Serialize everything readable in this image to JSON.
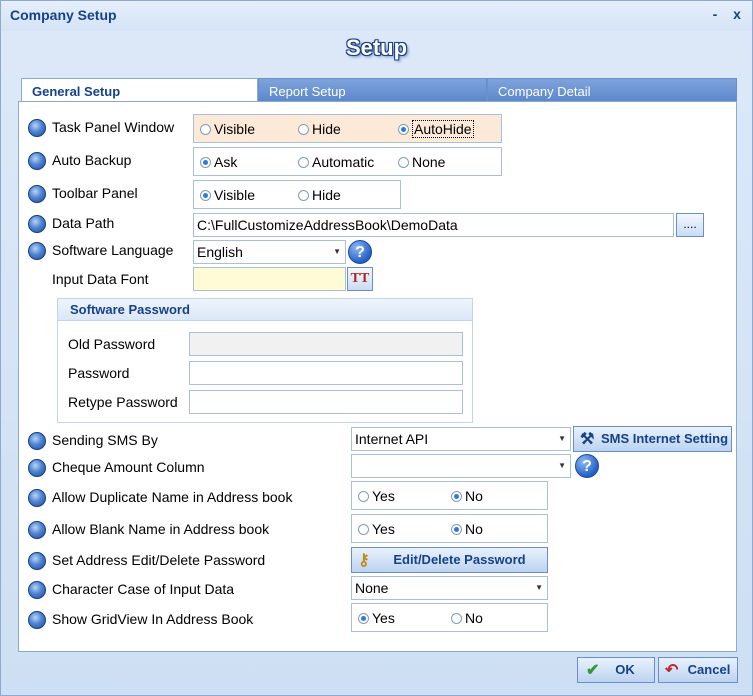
{
  "window": {
    "title": "Company Setup",
    "minimize": "-",
    "close": "x",
    "heading": "Setup"
  },
  "tabs": [
    {
      "label": "General Setup",
      "active": true
    },
    {
      "label": "Report Setup",
      "active": false
    },
    {
      "label": "Company Detail",
      "active": false
    }
  ],
  "general": {
    "task_panel": {
      "label": "Task Panel Window",
      "options": [
        "Visible",
        "Hide",
        "AutoHide"
      ],
      "selected": "AutoHide"
    },
    "auto_backup": {
      "label": "Auto Backup",
      "options": [
        "Ask",
        "Automatic",
        "None"
      ],
      "selected": "Ask"
    },
    "toolbar_panel": {
      "label": "Toolbar Panel",
      "options": [
        "Visible",
        "Hide"
      ],
      "selected": "Visible"
    },
    "data_path": {
      "label": "Data Path",
      "value": "C:\\FullCustomizeAddressBook\\DemoData",
      "browse": "...."
    },
    "language": {
      "label": "Software Language",
      "value": "English",
      "help": "?"
    },
    "input_font": {
      "label": "Input Data Font",
      "value": "",
      "font_btn": "TT"
    },
    "password_group": {
      "title": "Software Password",
      "old_label": "Old Password",
      "new_label": "Password",
      "retype_label": "Retype Password"
    },
    "sms": {
      "label": "Sending SMS By",
      "value": "Internet API",
      "button": "SMS Internet Setting"
    },
    "cheque": {
      "label": "Cheque Amount Column",
      "value": "",
      "help": "?"
    },
    "dup_name": {
      "label": "Allow Duplicate Name in Address book",
      "options": [
        "Yes",
        "No"
      ],
      "selected": "No"
    },
    "blank_name": {
      "label": "Allow Blank Name in Address book",
      "options": [
        "Yes",
        "No"
      ],
      "selected": "No"
    },
    "edit_pwd": {
      "label": "Set Address Edit/Delete Password",
      "button": "Edit/Delete Password"
    },
    "char_case": {
      "label": "Character Case of Input Data",
      "value": "None"
    },
    "gridview": {
      "label": "Show GridView In Address Book",
      "options": [
        "Yes",
        "No"
      ],
      "selected": "Yes"
    }
  },
  "footer": {
    "ok": "OK",
    "cancel": "Cancel"
  },
  "colors": {
    "accent": "#15428b",
    "highlight": "#fde9d8",
    "radio_on": "#2b7be0"
  }
}
